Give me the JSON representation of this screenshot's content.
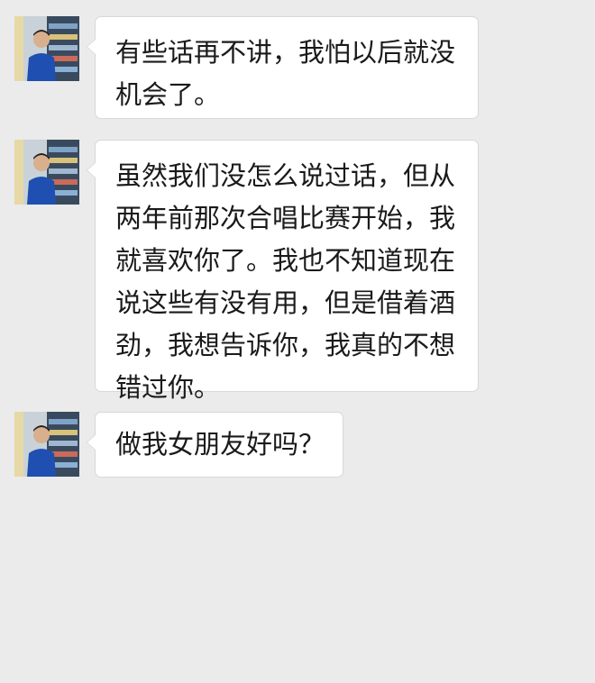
{
  "messages": [
    {
      "text": "有些话再不讲，我怕以后就没\n机会了。"
    },
    {
      "text": "虽然我们没怎么说过话，但从\n两年前那次合唱比赛开始，我\n就喜欢你了。我也不知道现在\n说这些有没有用，但是借着酒\n劲，我想告诉你，我真的不想\n错过你。"
    },
    {
      "text": "做我女朋友好吗？"
    }
  ]
}
